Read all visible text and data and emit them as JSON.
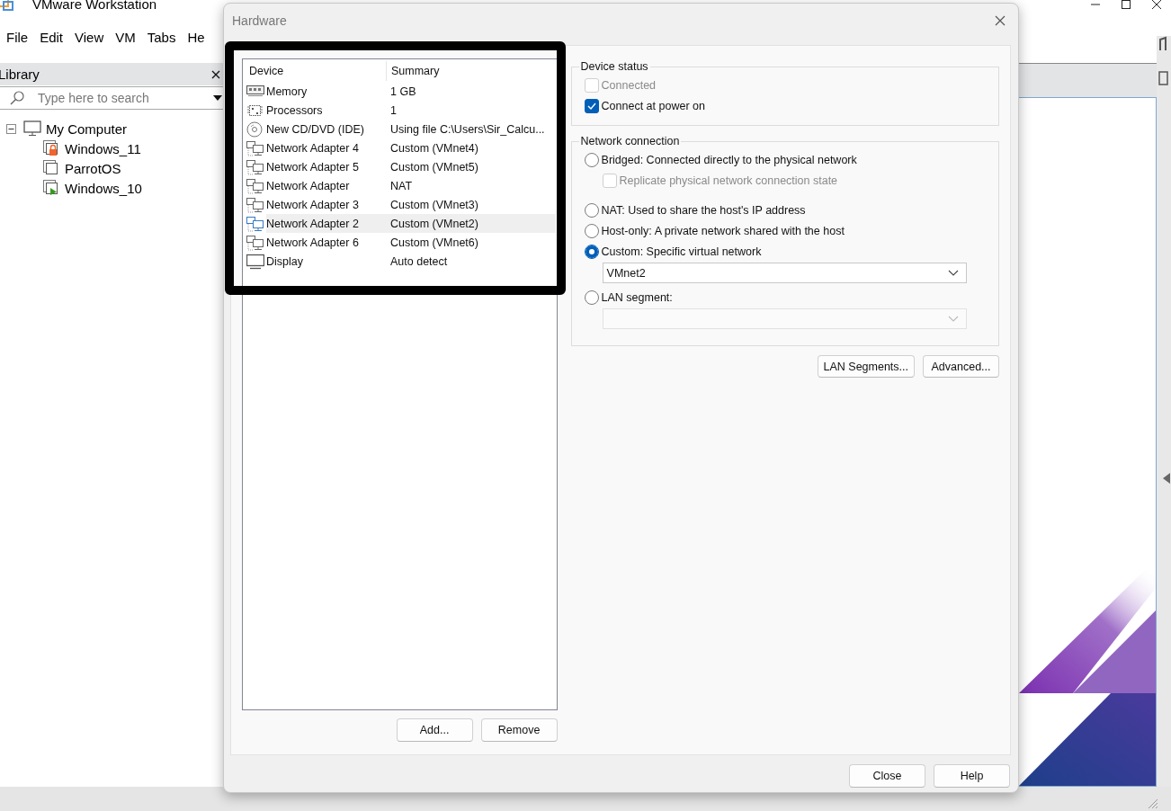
{
  "app": {
    "title": "VMware Workstation",
    "menu": [
      "File",
      "Edit",
      "View",
      "VM",
      "Tabs",
      "He"
    ],
    "library": {
      "title": "Library",
      "search": {
        "placeholder": "Type here to search"
      },
      "tree": [
        {
          "label": "My Computer",
          "expanded": true,
          "children": [
            {
              "label": "Windows_11",
              "kind": "locked"
            },
            {
              "label": "ParrotOS",
              "kind": "stopped"
            },
            {
              "label": "Windows_10",
              "kind": "running"
            }
          ]
        }
      ]
    }
  },
  "dialog": {
    "title": "Hardware",
    "columns": [
      "Device",
      "Summary"
    ],
    "devices": [
      {
        "device": "Memory",
        "summary": "1 GB",
        "kind": "memory",
        "selected": false
      },
      {
        "device": "Processors",
        "summary": "1",
        "kind": "cpu",
        "selected": false
      },
      {
        "device": "New CD/DVD (IDE)",
        "summary": "Using file C:\\Users\\Sir_Calcu...",
        "kind": "disc",
        "selected": false
      },
      {
        "device": "Network Adapter 4",
        "summary": "Custom (VMnet4)",
        "kind": "network",
        "selected": false
      },
      {
        "device": "Network Adapter 5",
        "summary": "Custom (VMnet5)",
        "kind": "network",
        "selected": false
      },
      {
        "device": "Network Adapter",
        "summary": "NAT",
        "kind": "network",
        "selected": false
      },
      {
        "device": "Network Adapter 3",
        "summary": "Custom (VMnet3)",
        "kind": "network",
        "selected": false
      },
      {
        "device": "Network Adapter 2",
        "summary": "Custom (VMnet2)",
        "kind": "network",
        "selected": true
      },
      {
        "device": "Network Adapter 6",
        "summary": "Custom (VMnet6)",
        "kind": "network",
        "selected": false
      },
      {
        "device": "Display",
        "summary": "Auto detect",
        "kind": "display",
        "selected": false
      }
    ],
    "list_buttons": [
      "Add...",
      "Remove"
    ],
    "device_status": {
      "title": "Device status",
      "items": [
        {
          "label": "Connected",
          "checked": false,
          "disabled": true
        },
        {
          "label": "Connect at power on",
          "checked": true,
          "disabled": false
        }
      ]
    },
    "network_connection": {
      "title": "Network connection",
      "items": [
        {
          "kind": "radio",
          "label": "Bridged: Connected directly to the physical network",
          "selected": false
        },
        {
          "kind": "checkbox",
          "label": "Replicate physical network connection state",
          "checked": false,
          "disabled": true
        },
        {
          "kind": "radio",
          "label": "NAT: Used to share the host's IP address",
          "selected": false
        },
        {
          "kind": "radio",
          "label": "Host-only: A private network shared with the host",
          "selected": false
        },
        {
          "kind": "radio",
          "label": "Custom: Specific virtual network",
          "selected": true
        },
        {
          "kind": "dropdown",
          "value": "VMnet2",
          "disabled": false
        },
        {
          "kind": "radio",
          "label": "LAN segment:",
          "selected": false
        },
        {
          "kind": "dropdown",
          "disabled": true
        }
      ]
    },
    "network_buttons": [
      "LAN Segments...",
      "Advanced..."
    ],
    "footer_buttons": [
      "Close",
      "Help"
    ]
  }
}
